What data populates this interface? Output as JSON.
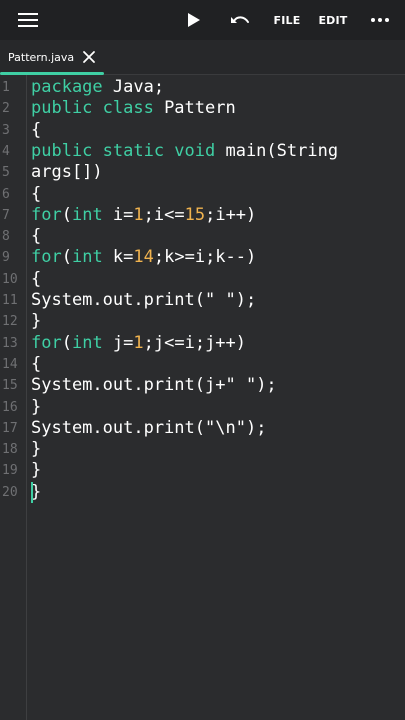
{
  "toolbar": {
    "menu_icon": "hamburger-menu-icon",
    "run_icon": "play-icon",
    "undo_icon": "undo-icon",
    "file_label": "FILE",
    "edit_label": "EDIT",
    "more_icon": "more-vertical-dots-icon"
  },
  "tabs": [
    {
      "label": "Pattern.java",
      "active": true
    }
  ],
  "colors": {
    "accent": "#3fcfa4",
    "number": "#f0b34f",
    "text": "#ffffff",
    "background": "#2b2c2e",
    "toolbar": "#202123"
  },
  "editor": {
    "line_numbers": [
      "1",
      "2",
      "3",
      "4",
      "5",
      "6",
      "7",
      "8",
      "9",
      "10",
      "11",
      "12",
      "13",
      "14",
      "15",
      "16",
      "17",
      "18",
      "19",
      "20"
    ],
    "code": [
      [
        {
          "t": "package",
          "c": "kw"
        },
        {
          "t": " Java;",
          "c": ""
        }
      ],
      [
        {
          "t": "public class",
          "c": "kw"
        },
        {
          "t": " Pattern",
          "c": ""
        }
      ],
      [
        {
          "t": "{",
          "c": ""
        }
      ],
      [
        {
          "t": "public static void",
          "c": "kw"
        },
        {
          "t": " main(String",
          "c": ""
        }
      ],
      [
        {
          "t": "args[])",
          "c": ""
        }
      ],
      [
        {
          "t": "{",
          "c": ""
        }
      ],
      [
        {
          "t": "for",
          "c": "kw"
        },
        {
          "t": "(",
          "c": ""
        },
        {
          "t": "int",
          "c": "kw"
        },
        {
          "t": " i=",
          "c": ""
        },
        {
          "t": "1",
          "c": "num"
        },
        {
          "t": ";i<=",
          "c": ""
        },
        {
          "t": "15",
          "c": "num"
        },
        {
          "t": ";i++)",
          "c": ""
        }
      ],
      [
        {
          "t": "{",
          "c": ""
        }
      ],
      [
        {
          "t": "for",
          "c": "kw"
        },
        {
          "t": "(",
          "c": ""
        },
        {
          "t": "int",
          "c": "kw"
        },
        {
          "t": " k=",
          "c": ""
        },
        {
          "t": "14",
          "c": "num"
        },
        {
          "t": ";k>=i;k--)",
          "c": ""
        }
      ],
      [
        {
          "t": "{",
          "c": ""
        }
      ],
      [
        {
          "t": "System.out.print(",
          "c": ""
        },
        {
          "t": "\" \"",
          "c": "str"
        },
        {
          "t": ");",
          "c": ""
        }
      ],
      [
        {
          "t": "}",
          "c": ""
        }
      ],
      [
        {
          "t": "for",
          "c": "kw"
        },
        {
          "t": "(",
          "c": ""
        },
        {
          "t": "int",
          "c": "kw"
        },
        {
          "t": " j=",
          "c": ""
        },
        {
          "t": "1",
          "c": "num"
        },
        {
          "t": ";j<=i;j++)",
          "c": ""
        }
      ],
      [
        {
          "t": "{",
          "c": ""
        }
      ],
      [
        {
          "t": "System.out.print(j+",
          "c": ""
        },
        {
          "t": "\" \"",
          "c": "str"
        },
        {
          "t": ");",
          "c": ""
        }
      ],
      [
        {
          "t": "}",
          "c": ""
        }
      ],
      [
        {
          "t": "System.out.print(",
          "c": ""
        },
        {
          "t": "\"\\n\"",
          "c": "str"
        },
        {
          "t": ");",
          "c": ""
        }
      ],
      [
        {
          "t": "}",
          "c": ""
        }
      ],
      [
        {
          "t": "}",
          "c": ""
        }
      ],
      [
        {
          "t": "}",
          "c": ""
        }
      ],
      [],
      []
    ],
    "code_row_for_line": [
      0,
      1,
      2,
      3,
      4,
      5,
      6,
      7,
      8,
      9,
      10,
      11,
      12,
      13,
      14,
      15,
      16,
      17,
      18,
      19
    ],
    "cursor_line": "20"
  }
}
